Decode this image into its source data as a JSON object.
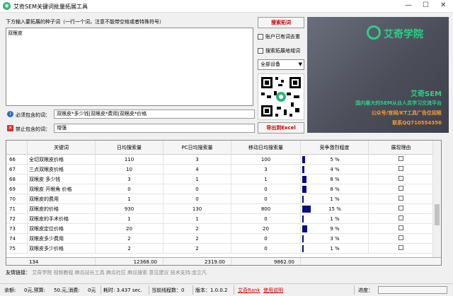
{
  "window": {
    "title": "艾奇SEM关键词批量拓展工具",
    "min": "—",
    "max": "☐",
    "close": "✕"
  },
  "top": {
    "seed_label": "下方输入要拓展的种子词（一行一个词，注意不能带空格或者特殊符号）",
    "seed_value": "双眼皮",
    "search_button": "搜索拓词",
    "check_dedup": "账户已有词去重",
    "check_region": "搜索拓展地域词",
    "device_select": "全部设备",
    "export_button": "导出到Excel",
    "include_label": "必须包含的词：",
    "include_value": "双眼皮*多少钱|双眼皮*费用|双眼皮*价格",
    "exclude_label": "禁止包含的词：",
    "exclude_value": "增强"
  },
  "promo": {
    "logo": "艾奇学院",
    "line1": "艾奇SEM",
    "line2": "国内最大的SEM从业人员学习交流平台",
    "line3": "公众号/官网/KT工具广告位招租",
    "line4": "联系QQ710554356"
  },
  "grid": {
    "headers": [
      "",
      "关键词",
      "日均搜索量",
      "PC日均搜索量",
      "移动日均搜索量",
      "竞争激烈程度",
      "展现理由"
    ],
    "rows": [
      {
        "n": "66",
        "kw": "全切双眼皮价格",
        "daily": "110",
        "pc": "3",
        "mobile": "100",
        "comp": 5,
        "comp_text": "5 %"
      },
      {
        "n": "67",
        "kw": "三点双眼皮价格",
        "daily": "10",
        "pc": "4",
        "mobile": "3",
        "comp": 4,
        "comp_text": "4 %"
      },
      {
        "n": "68",
        "kw": "双眼皮 多少钱",
        "daily": "3",
        "pc": "1",
        "mobile": "1",
        "comp": 8,
        "comp_text": "8 %"
      },
      {
        "n": "69",
        "kw": "双眼皮 开眼角 价格",
        "daily": "0",
        "pc": "0",
        "mobile": "0",
        "comp": 8,
        "comp_text": "8 %"
      },
      {
        "n": "70",
        "kw": "双眼皮的费用",
        "daily": "1",
        "pc": "0",
        "mobile": "0",
        "comp": 1,
        "comp_text": "1 %"
      },
      {
        "n": "71",
        "kw": "双眼皮的价格",
        "daily": "930",
        "pc": "130",
        "mobile": "800",
        "comp": 15,
        "comp_text": "15 %"
      },
      {
        "n": "72",
        "kw": "双眼皮的手术价格",
        "daily": "1",
        "pc": "1",
        "mobile": "0",
        "comp": 1,
        "comp_text": "1 %"
      },
      {
        "n": "73",
        "kw": "双眼皮定位价格",
        "daily": "20",
        "pc": "2",
        "mobile": "20",
        "comp": 9,
        "comp_text": "9 %"
      },
      {
        "n": "74",
        "kw": "双眼皮多少费用",
        "daily": "2",
        "pc": "2",
        "mobile": "0",
        "comp": 3,
        "comp_text": "3 %"
      },
      {
        "n": "75",
        "kw": "双眼皮多少价格",
        "daily": "2",
        "pc": "2",
        "mobile": "0",
        "comp": 1,
        "comp_text": "1 %"
      }
    ],
    "sum": {
      "count": "134",
      "daily": "12368.00",
      "pc": "2319.00",
      "mobile": "9862.00"
    }
  },
  "links": {
    "label": "友情链接：",
    "items": "艾奇学院  视频教程  麻瓜站长工具  麻瓜社区  麻瓜搜索  意见建议  技术支持:金立凡"
  },
  "status": {
    "balance": "余额:",
    "balance_val": "0元,预算:",
    "budget_val": "50.元,消费:",
    "spend_val": "0元",
    "time": "耗时: 3.437 sec.",
    "threads": "当前线程数：0",
    "version": "版本：1.0.0.2",
    "rank": "艾奇Rank",
    "help": "使用说明",
    "progress_label": "进度："
  },
  "colors": {
    "brand_green": "#2bd08a",
    "accent_red": "#cc0000",
    "bar_navy": "#0a0a80"
  }
}
